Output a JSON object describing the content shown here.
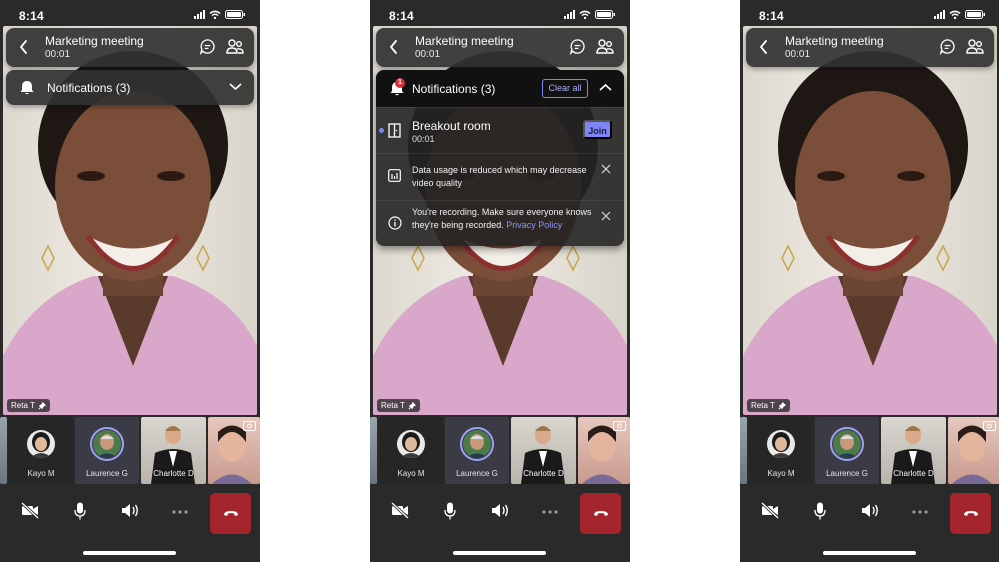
{
  "screens": [
    {
      "status_time": "8:14",
      "meeting_title": "Marketing meeting",
      "meeting_timer": "00:01",
      "notifications_label": "Notifications (3)",
      "state": "collapsed",
      "speaker_name": "Reta T"
    },
    {
      "status_time": "8:14",
      "meeting_title": "Marketing meeting",
      "meeting_timer": "00:01",
      "notifications_label": "Notifications (3)",
      "state": "expanded",
      "speaker_name": "Reta T",
      "unread_badge": "1",
      "clear_all_label": "Clear all",
      "notifications": [
        {
          "icon": "breakout-room-icon",
          "title": "Breakout room",
          "subtitle": "00:01",
          "action_label": "Join",
          "unread": true
        },
        {
          "icon": "data-usage-icon",
          "message": "Data usage is reduced which may decrease video quality"
        },
        {
          "icon": "info-icon",
          "message": "You're recording. Make sure everyone knows they're being recorded.",
          "link_label": "Privacy Policy"
        }
      ]
    },
    {
      "status_time": "8:14",
      "meeting_title": "Marketing meeting",
      "meeting_timer": "00:01",
      "state": "no-notifications",
      "speaker_name": "Reta T"
    }
  ],
  "participants": [
    {
      "name": "Kayo M",
      "type": "avatar"
    },
    {
      "name": "Laurence G",
      "type": "avatar-speaking"
    },
    {
      "name": "Charlotte D",
      "type": "video"
    },
    {
      "name": "",
      "type": "video-self"
    }
  ],
  "controls": {
    "video": "video-off",
    "mic": "mic-on",
    "speaker": "speaker-on",
    "more": "more-options",
    "hangup": "leave-call"
  },
  "colors": {
    "accent": "#7f85f5",
    "hangup": "#a4262c",
    "badge": "#d13438",
    "background": "#2a2a2a"
  }
}
